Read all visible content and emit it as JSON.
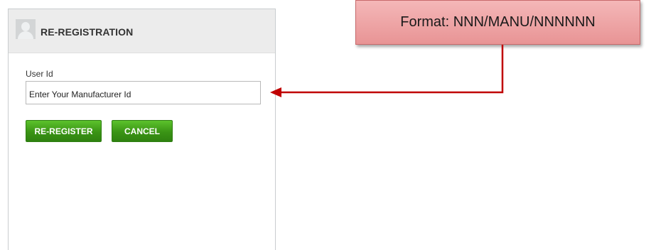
{
  "panel": {
    "title": "RE-REGISTRATION",
    "avatar_icon": "user-avatar-icon"
  },
  "form": {
    "user_id_label": "User Id",
    "user_id_value": "Enter Your Manufacturer Id"
  },
  "buttons": {
    "reregister": "RE-REGISTER",
    "cancel": "CANCEL"
  },
  "callout": {
    "text": "Format: NNN/MANU/NNNNNN"
  },
  "colors": {
    "button_green": "#3a9415",
    "callout_fill": "#eea5a6",
    "arrow": "#c00000"
  }
}
